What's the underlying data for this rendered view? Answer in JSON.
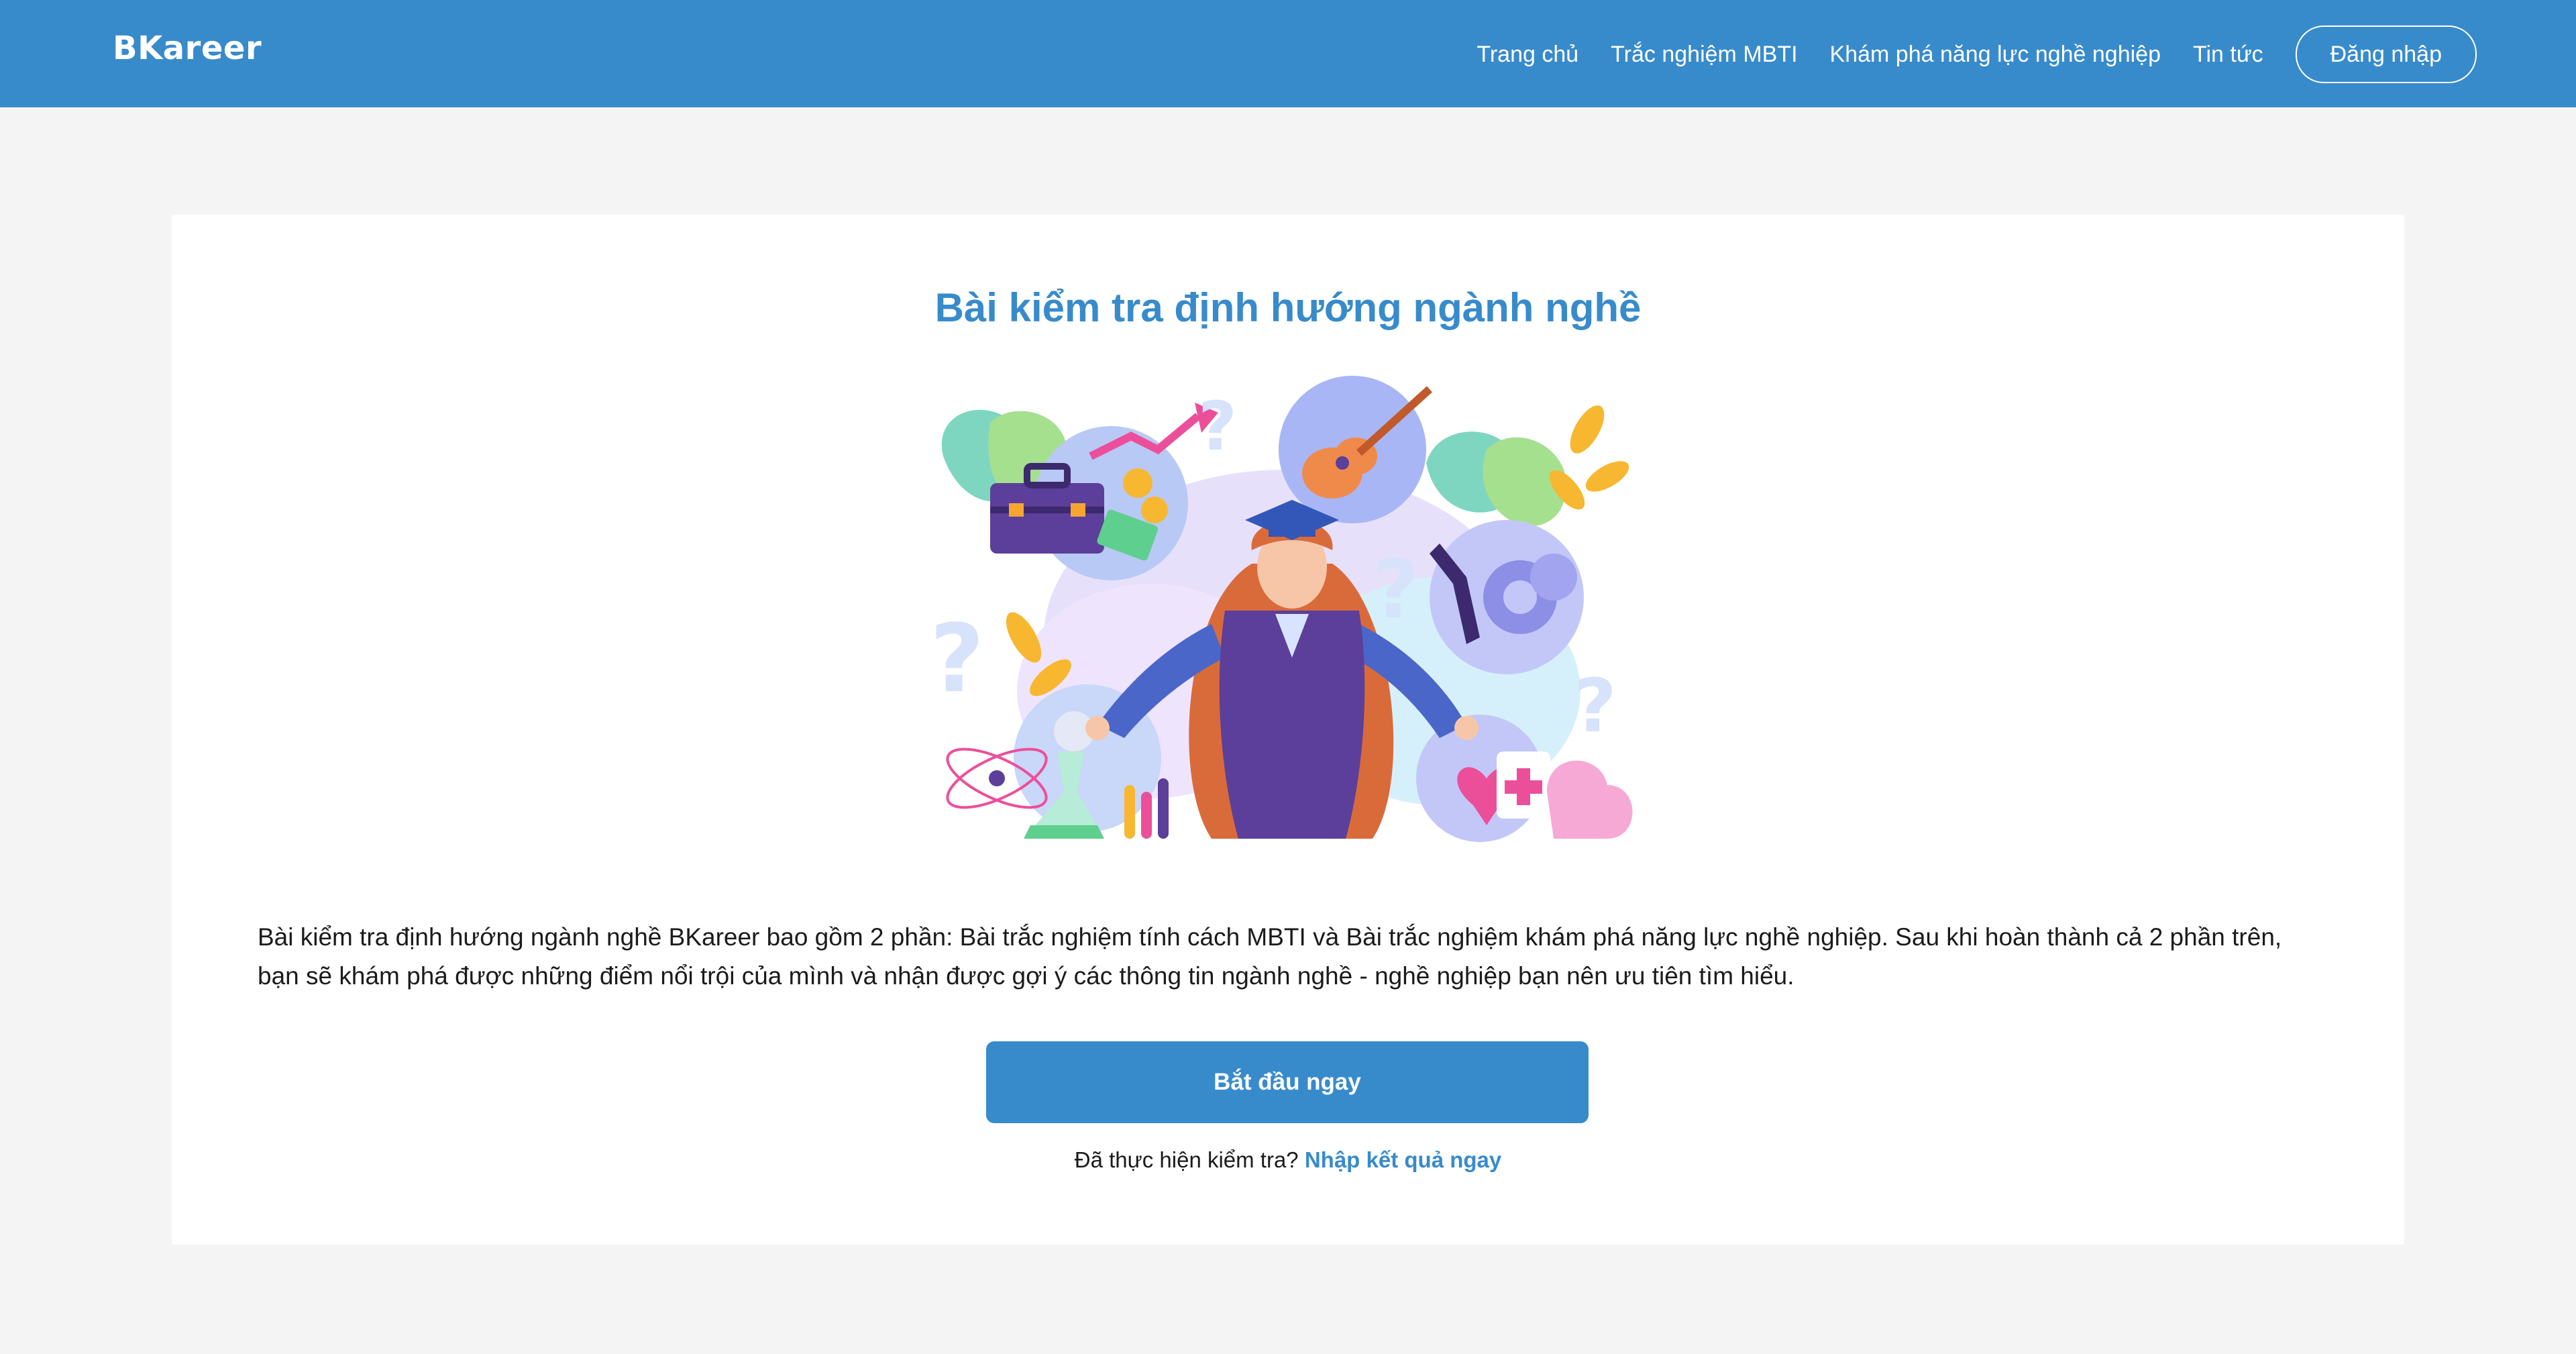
{
  "header": {
    "logo": "BKareer",
    "nav": [
      {
        "label": "Trang chủ"
      },
      {
        "label": "Trắc nghiệm MBTI"
      },
      {
        "label": "Khám phá năng lực nghề nghiệp"
      },
      {
        "label": "Tin tức"
      }
    ],
    "login_label": "Đăng nhập",
    "brand_color": "#388bcb"
  },
  "main": {
    "title": "Bài kiểm tra định hướng ngành nghề",
    "illustration": "career-orientation-graduate-illustration",
    "description": "Bài kiểm tra định hướng ngành nghề BKareer bao gồm 2 phần: Bài trắc nghiệm tính cách MBTI và Bài trắc nghiệm khám phá năng lực nghề nghiệp. Sau khi hoàn thành cả 2 phần trên, bạn sẽ khám phá được những điểm nổi trội của mình và nhận được gợi ý các thông tin ngành nghề - nghề nghiệp bạn nên ưu tiên tìm hiểu.",
    "start_button": "Bắt đầu ngay",
    "done_text": "Đã thực hiện kiểm tra?",
    "done_link": "Nhập kết quả ngay"
  }
}
